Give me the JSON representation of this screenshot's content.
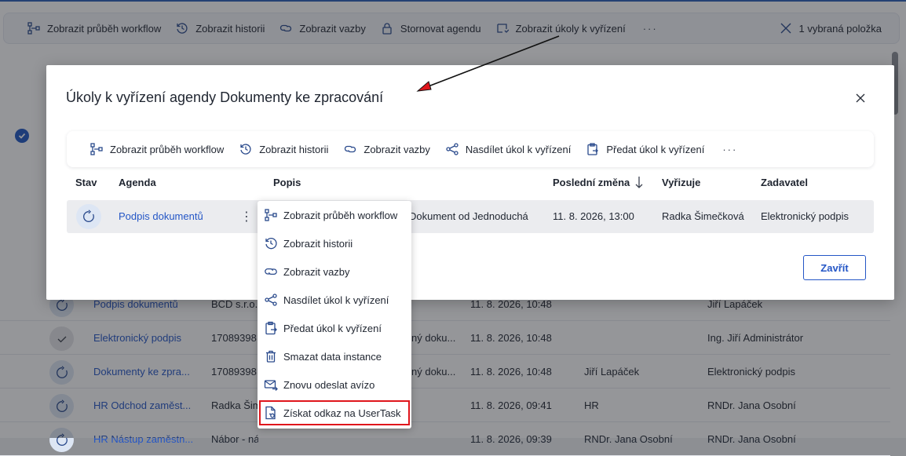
{
  "background": {
    "toolbar": {
      "items": [
        {
          "label": "Zobrazit průběh workflow",
          "icon": "workflow-icon"
        },
        {
          "label": "Zobrazit historii",
          "icon": "history-icon"
        },
        {
          "label": "Zobrazit vazby",
          "icon": "link-icon"
        },
        {
          "label": "Stornovat agendu",
          "icon": "lock-icon"
        },
        {
          "label": "Zobrazit úkoly k vyřízení",
          "icon": "tasks-icon"
        }
      ],
      "more": "···",
      "selected": "1 vybraná položka"
    },
    "rows": [
      {
        "agenda": "Podpis dokumentů",
        "popis": "BCD s.r.o.",
        "popis2": "",
        "date": "11. 8. 2026, 10:48",
        "vyrizuje": "",
        "zadavatel": "Jiří Lapáček",
        "state": "sync"
      },
      {
        "agenda": "Elektronický podpis",
        "popis": "17089398",
        "popis2": "ný doku...",
        "date": "11. 8. 2026, 10:48",
        "vyrizuje": "",
        "zadavatel": "Ing. Jiří Administrátor",
        "state": "done"
      },
      {
        "agenda": "Dokumenty ke zpra...",
        "popis": "17089398",
        "popis2": "ný doku...",
        "date": "11. 8. 2026, 10:48",
        "vyrizuje": "Jiří Lapáček",
        "zadavatel": "Elektronický podpis",
        "state": "sync"
      },
      {
        "agenda": "HR Odchod zaměst...",
        "popis": "Radka Šim",
        "popis2": "",
        "date": "11. 8. 2026, 09:41",
        "vyrizuje": "HR",
        "zadavatel": "RNDr. Jana Osobní",
        "state": "sync"
      },
      {
        "agenda": "HR Nástup zaměstn...",
        "popis": "Nábor - nástup",
        "popis2": "",
        "date": "11. 8. 2026, 09:39",
        "vyrizuje": "RNDr. Jana Osobní",
        "zadavatel": "RNDr. Jana Osobní",
        "state": "sync"
      }
    ]
  },
  "modal": {
    "title": "Úkoly k vyřízení agendy Dokumenty ke zpracování",
    "toolbar": {
      "items": [
        {
          "label": "Zobrazit průběh workflow",
          "icon": "workflow-icon"
        },
        {
          "label": "Zobrazit historii",
          "icon": "history-icon"
        },
        {
          "label": "Zobrazit vazby",
          "icon": "link-icon"
        },
        {
          "label": "Nasdílet úkol k vyřízení",
          "icon": "share-icon"
        },
        {
          "label": "Předat úkol k vyřízení",
          "icon": "handover-icon"
        }
      ],
      "more": "···"
    },
    "columns": {
      "stav": "Stav",
      "agenda": "Agenda",
      "popis": "Popis",
      "posledni_zmena": "Poslední změna",
      "vyrizuje": "Vyřizuje",
      "zadavatel": "Zadavatel"
    },
    "row": {
      "agenda": "Podpis dokumentů",
      "popis": "Dokument od Jednoduchá",
      "date": "11. 8. 2026, 13:00",
      "vyrizuje": "Radka Šimečková",
      "zadavatel": "Elektronický podpis"
    },
    "close_label": "Zavřít"
  },
  "context_menu": {
    "items": [
      {
        "label": "Zobrazit průběh workflow",
        "icon": "workflow-icon"
      },
      {
        "label": "Zobrazit historii",
        "icon": "history-icon"
      },
      {
        "label": "Zobrazit vazby",
        "icon": "link-icon"
      },
      {
        "label": "Nasdílet úkol k vyřízení",
        "icon": "share-icon"
      },
      {
        "label": "Předat úkol k vyřízení",
        "icon": "handover-icon"
      },
      {
        "label": "Smazat data instance",
        "icon": "trash-icon"
      },
      {
        "label": "Znovu odeslat avízo",
        "icon": "mail-resend-icon"
      },
      {
        "label": "Získat odkaz na UserTask",
        "icon": "document-link-icon",
        "highlighted": true
      }
    ]
  },
  "colors": {
    "accent": "#2456c6",
    "highlight": "#e0161c",
    "row_selected": "#ebecef"
  }
}
